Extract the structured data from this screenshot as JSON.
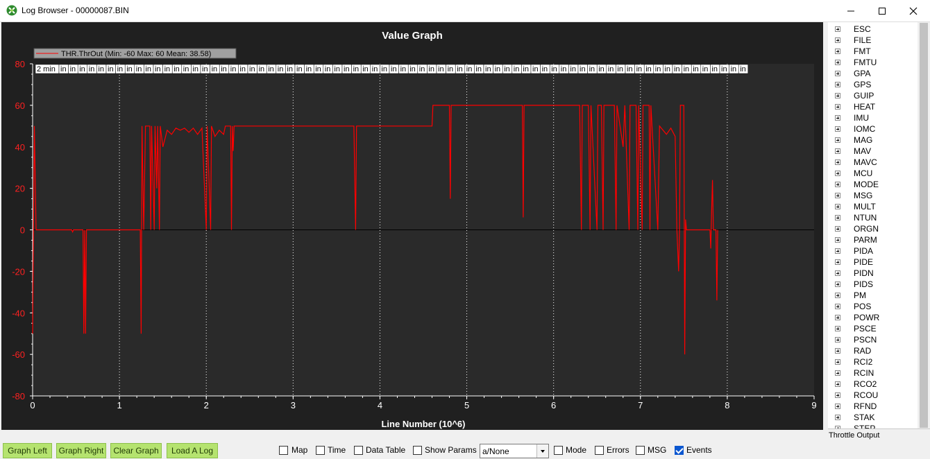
{
  "window": {
    "title": "Log Browser - 00000087.BIN"
  },
  "graph": {
    "heading": "Value Graph",
    "legend": "THR.ThrOut  (Min: -60 Max: 60 Mean: 38.58)",
    "event_first": "2 min",
    "event_rest": "in",
    "event_count": 75,
    "series_color": "#ff0000",
    "x_label": "Line Number (10^6)"
  },
  "chart_data": {
    "type": "line",
    "title": "Value Graph",
    "xlabel": "Line Number (10^6)",
    "ylabel": "",
    "xlim": [
      0,
      9
    ],
    "ylim": [
      -80,
      80
    ],
    "x_ticks": [
      "0",
      "1",
      "2",
      "3",
      "4",
      "5",
      "6",
      "7",
      "8",
      "9"
    ],
    "y_ticks": [
      "80",
      "60",
      "40",
      "20",
      "0",
      "-20",
      "-40",
      "-60",
      "-80"
    ],
    "legend": "top-left",
    "series": [
      {
        "name": "THR.ThrOut",
        "color": "#ff0000",
        "points": [
          [
            0.0,
            -50
          ],
          [
            0.02,
            50
          ],
          [
            0.04,
            0
          ],
          [
            0.45,
            0
          ],
          [
            0.46,
            -1
          ],
          [
            0.47,
            0
          ],
          [
            0.58,
            0
          ],
          [
            0.59,
            -50
          ],
          [
            0.6,
            0
          ],
          [
            0.61,
            -50
          ],
          [
            0.62,
            0
          ],
          [
            1.24,
            0
          ],
          [
            1.25,
            -50
          ],
          [
            1.26,
            50
          ],
          [
            1.28,
            0
          ],
          [
            1.3,
            50
          ],
          [
            1.35,
            50
          ],
          [
            1.36,
            0
          ],
          [
            1.37,
            50
          ],
          [
            1.4,
            0
          ],
          [
            1.41,
            50
          ],
          [
            1.43,
            20
          ],
          [
            1.44,
            50
          ],
          [
            1.46,
            0
          ],
          [
            1.47,
            50
          ],
          [
            1.5,
            40
          ],
          [
            1.55,
            48
          ],
          [
            1.6,
            46
          ],
          [
            1.65,
            49
          ],
          [
            1.7,
            48
          ],
          [
            1.75,
            49
          ],
          [
            1.8,
            47
          ],
          [
            1.85,
            49
          ],
          [
            1.9,
            46
          ],
          [
            1.95,
            49
          ],
          [
            2.0,
            0
          ],
          [
            2.01,
            50
          ],
          [
            2.05,
            0
          ],
          [
            2.06,
            50
          ],
          [
            2.1,
            45
          ],
          [
            2.15,
            48
          ],
          [
            2.2,
            46
          ],
          [
            2.22,
            50
          ],
          [
            2.28,
            50
          ],
          [
            2.29,
            0
          ],
          [
            2.3,
            50
          ],
          [
            2.31,
            38
          ],
          [
            2.32,
            50
          ],
          [
            3.7,
            50
          ],
          [
            3.72,
            0
          ],
          [
            3.73,
            50
          ],
          [
            4.6,
            50
          ],
          [
            4.61,
            60
          ],
          [
            4.8,
            60
          ],
          [
            4.81,
            15
          ],
          [
            4.82,
            60
          ],
          [
            5.64,
            60
          ],
          [
            5.65,
            6
          ],
          [
            5.66,
            60
          ],
          [
            6.3,
            60
          ],
          [
            6.32,
            0
          ],
          [
            6.33,
            60
          ],
          [
            6.4,
            60
          ],
          [
            6.42,
            0
          ],
          [
            6.43,
            60
          ],
          [
            6.5,
            0
          ],
          [
            6.51,
            60
          ],
          [
            6.55,
            60
          ],
          [
            6.57,
            0
          ],
          [
            6.58,
            60
          ],
          [
            6.7,
            60
          ],
          [
            6.72,
            0
          ],
          [
            6.73,
            60
          ],
          [
            6.8,
            40
          ],
          [
            6.82,
            60
          ],
          [
            6.87,
            0
          ],
          [
            6.88,
            60
          ],
          [
            6.95,
            60
          ],
          [
            6.97,
            0
          ],
          [
            6.98,
            60
          ],
          [
            7.02,
            0
          ],
          [
            7.03,
            60
          ],
          [
            7.1,
            60
          ],
          [
            7.11,
            0
          ],
          [
            7.12,
            60
          ],
          [
            7.2,
            0
          ],
          [
            7.22,
            50
          ],
          [
            7.3,
            46
          ],
          [
            7.35,
            49
          ],
          [
            7.4,
            45
          ],
          [
            7.42,
            0
          ],
          [
            7.44,
            -20
          ],
          [
            7.45,
            0
          ],
          [
            7.46,
            60
          ],
          [
            7.5,
            60
          ],
          [
            7.51,
            -60
          ],
          [
            7.52,
            5
          ],
          [
            7.53,
            0
          ],
          [
            7.8,
            0
          ],
          [
            7.81,
            -9
          ],
          [
            7.82,
            10
          ],
          [
            7.83,
            24
          ],
          [
            7.84,
            0
          ],
          [
            7.87,
            0
          ],
          [
            7.88,
            -34
          ],
          [
            7.89,
            0
          ]
        ]
      }
    ]
  },
  "tree": {
    "items": [
      "ESC",
      "FILE",
      "FMT",
      "FMTU",
      "GPA",
      "GPS",
      "GUIP",
      "HEAT",
      "IMU",
      "IOMC",
      "MAG",
      "MAV",
      "MAVC",
      "MCU",
      "MODE",
      "MSG",
      "MULT",
      "NTUN",
      "ORGN",
      "PARM",
      "PIDA",
      "PIDE",
      "PIDN",
      "PIDS",
      "PM",
      "POS",
      "POWR",
      "PSCE",
      "PSCN",
      "RAD",
      "RCI2",
      "RCIN",
      "RCO2",
      "RCOU",
      "RFND",
      "STAK",
      "STEP"
    ],
    "description": "Throttle Output"
  },
  "buttons": {
    "graph_left": "Graph Left",
    "graph_right": "Graph Right",
    "clear_graph": "Clear Graph",
    "load_log": "Load A Log"
  },
  "options": {
    "map": "Map",
    "time": "Time",
    "data_table": "Data Table",
    "show_params": "Show Params",
    "combo_value": "a/None",
    "mode": "Mode",
    "errors": "Errors",
    "msg": "MSG",
    "events": "Events",
    "events_checked": true
  },
  "colors": {
    "accent_button": "#b5e36f",
    "graph_bg": "#202020",
    "plot_bg": "#2a2a2a"
  }
}
